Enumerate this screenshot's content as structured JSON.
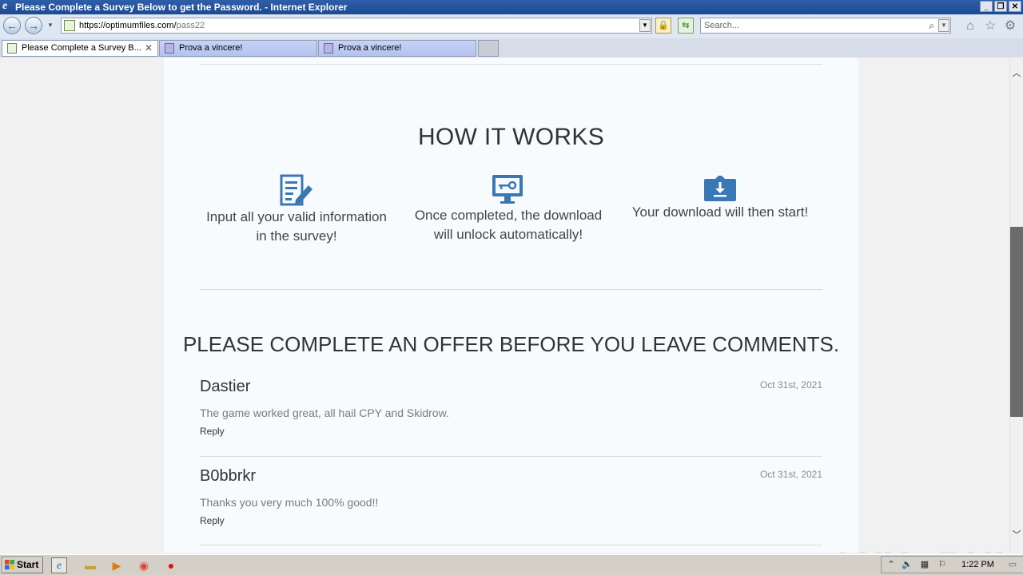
{
  "window": {
    "title": "Please Complete a Survey Below to get the Password. - Internet Explorer",
    "controls": {
      "minimize": "_",
      "restore": "❐",
      "close": "✕"
    }
  },
  "addressbar": {
    "url_host": "https://optimumfiles.com/",
    "url_path": "pass22",
    "search_placeholder": "Search..."
  },
  "tabs": [
    {
      "label": "Please Complete a Survey B...",
      "active": true
    },
    {
      "label": "Prova a vincere!",
      "active": false
    },
    {
      "label": "Prova a vincere!",
      "active": false
    }
  ],
  "page": {
    "how_it_works_title": "HOW IT WORKS",
    "steps": [
      {
        "icon": "survey-form-icon",
        "line1": "Input all your valid information",
        "line2": "in the survey!"
      },
      {
        "icon": "unlock-key-monitor-icon",
        "line1": "Once completed, the download",
        "line2": "will unlock automatically!"
      },
      {
        "icon": "download-icon",
        "line1": "Your download will then start!",
        "line2": ""
      }
    ],
    "offer_title": "PLEASE COMPLETE AN OFFER BEFORE YOU LEAVE COMMENTS.",
    "comments": [
      {
        "name": "Dastier",
        "date": "Oct 31st, 2021",
        "text": "The game worked great, all hail CPY and Skidrow.",
        "reply": "Reply"
      },
      {
        "name": "B0bbrkr",
        "date": "Oct 31st, 2021",
        "text": "Thanks you very much 100% good!!",
        "reply": "Reply"
      }
    ]
  },
  "watermark": "ANY▷RUN",
  "taskbar": {
    "start_label": "Start",
    "time": "1:22 PM"
  },
  "colors": {
    "icon_blue": "#3a78b5",
    "titlebar": "#1d4a92"
  }
}
